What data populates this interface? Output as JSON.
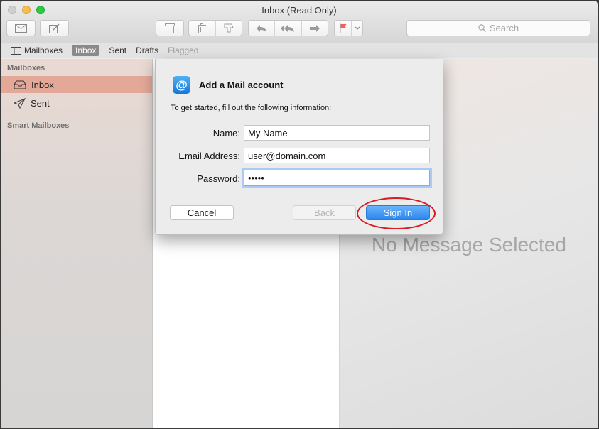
{
  "window": {
    "title": "Inbox (Read Only)"
  },
  "toolbar": {
    "search_placeholder": "Search",
    "icons": [
      "envelope-icon",
      "compose-icon",
      "archive-icon",
      "trash-icon",
      "junk-icon",
      "reply-icon",
      "reply-all-icon",
      "forward-icon",
      "flag-icon",
      "chevron-down-icon",
      "search-icon"
    ],
    "flag_color": "#f0615b"
  },
  "favorites": {
    "items": [
      {
        "label": "Mailboxes",
        "state": "normal"
      },
      {
        "label": "Inbox",
        "state": "active"
      },
      {
        "label": "Sent",
        "state": "normal"
      },
      {
        "label": "Drafts",
        "state": "normal"
      },
      {
        "label": "Flagged",
        "state": "dimmed"
      }
    ]
  },
  "sidebar": {
    "heading": "Mailboxes",
    "items": [
      {
        "label": "Inbox",
        "icon": "inbox-tray-icon",
        "selected": true
      },
      {
        "label": "Sent",
        "icon": "paper-plane-icon",
        "selected": false
      }
    ],
    "smart_heading": "Smart Mailboxes",
    "selection_color": "#e4a899"
  },
  "viewer": {
    "empty_text": "No Message Selected"
  },
  "dialog": {
    "icon": "at-sign-icon",
    "icon_glyph": "@",
    "title": "Add a Mail account",
    "intro": "To get started, fill out the following information:",
    "fields": {
      "name": {
        "label": "Name:",
        "value": "My Name"
      },
      "email": {
        "label": "Email Address:",
        "value": "user@domain.com"
      },
      "password": {
        "label": "Password:",
        "value": "•••••",
        "focused": true
      }
    },
    "buttons": {
      "cancel": "Cancel",
      "back": "Back",
      "signin": "Sign In"
    },
    "back_enabled": false,
    "accent_color": "#2a86ee",
    "annotation_color": "#d81c22"
  }
}
